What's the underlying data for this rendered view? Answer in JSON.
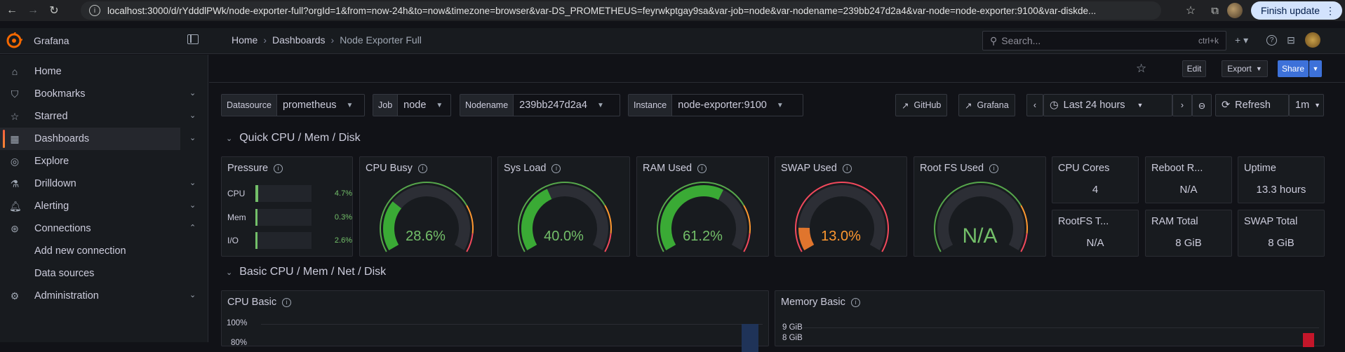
{
  "browser": {
    "url": "localhost:3000/d/rYdddlPWk/node-exporter-full?orgId=1&from=now-24h&to=now&timezone=browser&var-DS_PROMETHEUS=feyrwkptgay9sa&var-job=node&var-nodename=239bb247d2a4&var-node=node-exporter:9100&var-diskde...",
    "finish_update": "Finish update"
  },
  "topbar": {
    "brand": "Grafana",
    "breadcrumb": [
      "Home",
      "Dashboards",
      "Node Exporter Full"
    ],
    "search_placeholder": "Search...",
    "search_shortcut": "ctrl+k"
  },
  "sidebar": {
    "items": [
      {
        "label": "Home",
        "icon": "home-icon"
      },
      {
        "label": "Bookmarks",
        "icon": "bookmark-icon"
      },
      {
        "label": "Starred",
        "icon": "star-icon"
      },
      {
        "label": "Dashboards",
        "icon": "apps-icon"
      },
      {
        "label": "Explore",
        "icon": "compass-icon"
      },
      {
        "label": "Drilldown",
        "icon": "drilldown-icon"
      },
      {
        "label": "Alerting",
        "icon": "bell-icon"
      },
      {
        "label": "Connections",
        "icon": "connections-icon"
      },
      {
        "label": "Add new connection"
      },
      {
        "label": "Data sources"
      },
      {
        "label": "Administration",
        "icon": "cog-icon"
      }
    ]
  },
  "toolbar": {
    "edit": "Edit",
    "export": "Export",
    "share": "Share"
  },
  "variables": {
    "datasource": {
      "label": "Datasource",
      "value": "prometheus"
    },
    "job": {
      "label": "Job",
      "value": "node"
    },
    "nodename": {
      "label": "Nodename",
      "value": "239bb247d2a4"
    },
    "instance": {
      "label": "Instance",
      "value": "node-exporter:9100"
    }
  },
  "links": {
    "github": "GitHub",
    "grafana": "Grafana"
  },
  "time": {
    "range": "Last 24 hours",
    "refresh": "Refresh",
    "interval": "1m"
  },
  "rows": {
    "quick": "Quick CPU / Mem / Disk",
    "basic": "Basic CPU / Mem / Net / Disk"
  },
  "panels": {
    "pressure": {
      "title": "Pressure",
      "bars": [
        {
          "label": "CPU",
          "value": "4.7%",
          "fraction": 0.047
        },
        {
          "label": "Mem",
          "value": "0.3%",
          "fraction": 0.003
        },
        {
          "label": "I/O",
          "value": "2.6%",
          "fraction": 0.026
        }
      ]
    },
    "cpu_busy": {
      "title": "CPU Busy",
      "value": "28.6%",
      "fraction": 0.286
    },
    "sys_load": {
      "title": "Sys Load",
      "value": "40.0%",
      "fraction": 0.4
    },
    "ram_used": {
      "title": "RAM Used",
      "value": "61.2%",
      "fraction": 0.612
    },
    "swap_used": {
      "title": "SWAP Used",
      "value": "13.0%",
      "fraction": 0.13
    },
    "rootfs_used": {
      "title": "Root FS Used",
      "value": "N/A"
    },
    "cpu_cores": {
      "title": "CPU Cores",
      "value": "4"
    },
    "reboot": {
      "title": "Reboot R...",
      "value": "N/A"
    },
    "uptime": {
      "title": "Uptime",
      "value": "13.3 hours"
    },
    "rootfs_total": {
      "title": "RootFS T...",
      "value": "N/A"
    },
    "ram_total": {
      "title": "RAM Total",
      "value": "8 GiB"
    },
    "swap_total": {
      "title": "SWAP Total",
      "value": "8 GiB"
    },
    "cpu_basic": {
      "title": "CPU Basic",
      "y_top": "100%",
      "y_next": "80%"
    },
    "memory_basic": {
      "title": "Memory Basic",
      "y_top": "9 GiB",
      "y_next": "8 GiB"
    }
  },
  "colors": {
    "green": "#73bf69",
    "orange": "#ff9830",
    "red": "#f2495c",
    "blue": "#3d71d9",
    "gauge_green": "#37872d",
    "gauge_orange": "#e0752d"
  }
}
